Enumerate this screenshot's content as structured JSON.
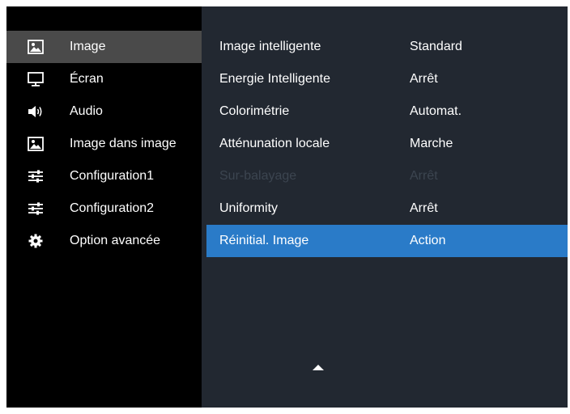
{
  "menu": {
    "items": [
      {
        "label": "Image",
        "icon": "image-icon",
        "active": true
      },
      {
        "label": "Écran",
        "icon": "monitor-icon"
      },
      {
        "label": "Audio",
        "icon": "speaker-icon"
      },
      {
        "label": "Image dans image",
        "icon": "image-icon"
      },
      {
        "label": "Configuration1",
        "icon": "sliders-icon"
      },
      {
        "label": "Configuration2",
        "icon": "sliders-icon"
      },
      {
        "label": "Option avancée",
        "icon": "gear-icon"
      }
    ]
  },
  "settings": {
    "rows": [
      {
        "label": "Image intelligente",
        "value": "Standard"
      },
      {
        "label": "Energie Intelligente",
        "value": "Arrêt"
      },
      {
        "label": "Colorimétrie",
        "value": "Automat."
      },
      {
        "label": "Atténunation locale",
        "value": "Marche"
      },
      {
        "label": "Sur-balayage",
        "value": "Arrêt",
        "disabled": true
      },
      {
        "label": "Uniformity",
        "value": "Arrêt"
      },
      {
        "label": "Réinitial. Image",
        "value": "Action",
        "selected": true
      }
    ]
  },
  "colors": {
    "left_bg": "#000000",
    "right_bg": "#222831",
    "active_item_bg": "#4a4a4a",
    "selected_row_bg": "#2a7bc8",
    "disabled_text": "#3c4550"
  }
}
